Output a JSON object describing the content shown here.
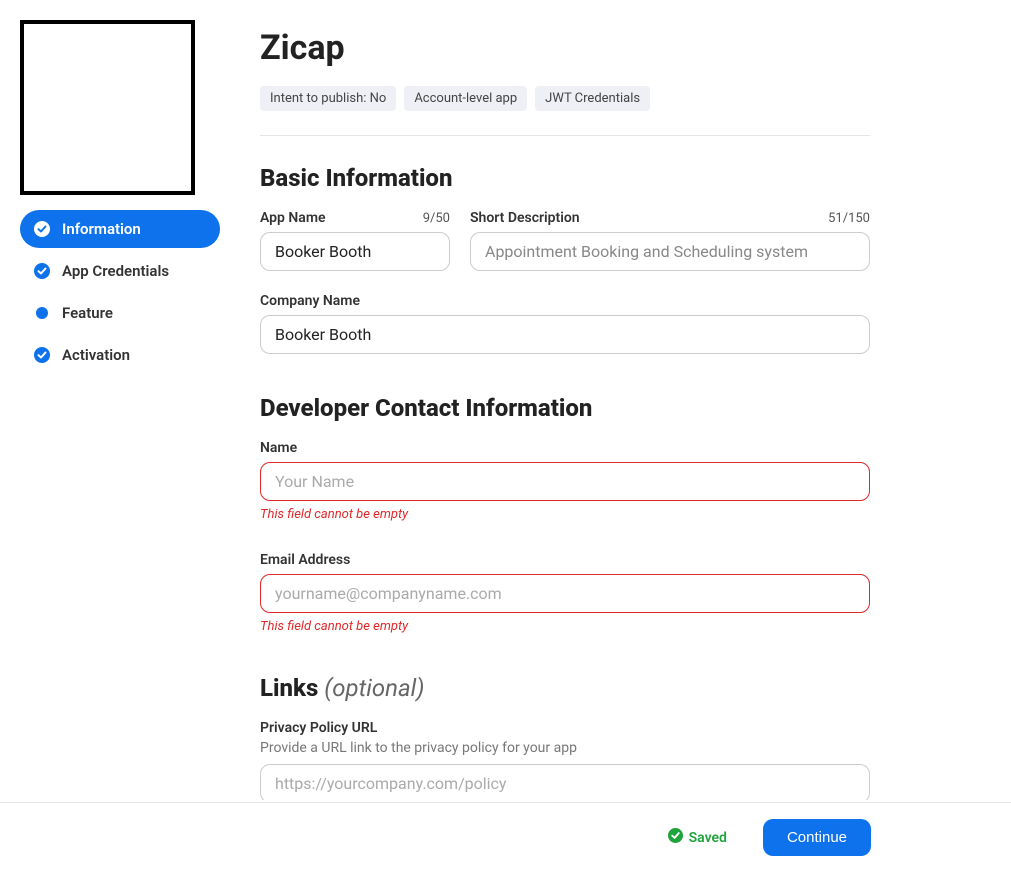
{
  "app": {
    "title": "Zicap",
    "badges": [
      "Intent to publish: No",
      "Account-level app",
      "JWT Credentials"
    ]
  },
  "sidebar": {
    "items": [
      {
        "label": "Information",
        "active": true,
        "icon": "check"
      },
      {
        "label": "App Credentials",
        "active": false,
        "icon": "check"
      },
      {
        "label": "Feature",
        "active": false,
        "icon": "dot"
      },
      {
        "label": "Activation",
        "active": false,
        "icon": "check"
      }
    ]
  },
  "sections": {
    "basic": {
      "title": "Basic Information",
      "appName": {
        "label": "App Name",
        "value": "Booker Booth",
        "count": "9/50"
      },
      "shortDesc": {
        "label": "Short Description",
        "value": "Appointment Booking and Scheduling system",
        "count": "51/150"
      },
      "companyName": {
        "label": "Company Name",
        "value": "Booker Booth"
      }
    },
    "developer": {
      "title": "Developer Contact Information",
      "name": {
        "label": "Name",
        "placeholder": "Your Name",
        "error": "This field cannot be empty"
      },
      "email": {
        "label": "Email Address",
        "placeholder": "yourname@companyname.com",
        "error": "This field cannot be empty"
      }
    },
    "links": {
      "title": "Links",
      "optional": "(optional)",
      "privacy": {
        "label": "Privacy Policy URL",
        "help": "Provide a URL link to the privacy policy for your app",
        "placeholder": "https://yourcompany.com/policy"
      }
    }
  },
  "footer": {
    "saved": "Saved",
    "continue": "Continue"
  }
}
